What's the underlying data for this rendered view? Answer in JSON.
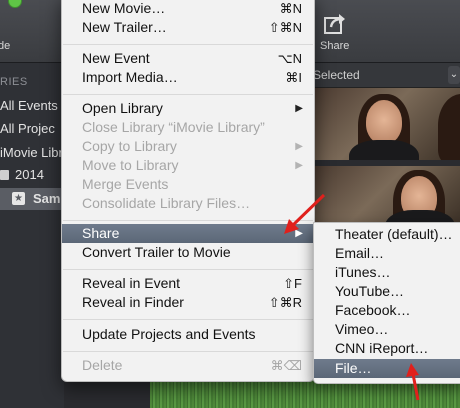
{
  "toolbar": {
    "left_label": "de",
    "share_label": "Share"
  },
  "browser": {
    "selected_label": "Selected",
    "chevron": "⌄"
  },
  "sidebar": {
    "header": "RIES",
    "items": [
      {
        "label": "All Events"
      },
      {
        "label": "All Projec"
      },
      {
        "label": "iMovie Libr"
      },
      {
        "label": "2014"
      },
      {
        "label": "Sam"
      }
    ]
  },
  "menu": {
    "items": [
      {
        "label": "New Movie…",
        "shortcut": "⌘N",
        "enabled": true
      },
      {
        "label": "New Trailer…",
        "shortcut": "⇧⌘N",
        "enabled": true
      },
      {
        "label": "New Event",
        "shortcut": "⌥N",
        "enabled": true
      },
      {
        "label": "Import Media…",
        "shortcut": "⌘I",
        "enabled": true
      },
      {
        "label": "Open Library",
        "submenu": true,
        "enabled": true
      },
      {
        "label": "Close Library “iMovie Library”",
        "enabled": false
      },
      {
        "label": "Copy to Library",
        "submenu": true,
        "enabled": false
      },
      {
        "label": "Move to Library",
        "submenu": true,
        "enabled": false
      },
      {
        "label": "Merge Events",
        "enabled": false
      },
      {
        "label": "Consolidate Library Files…",
        "enabled": false
      },
      {
        "label": "Share",
        "submenu": true,
        "enabled": true,
        "highlighted": true
      },
      {
        "label": "Convert Trailer to Movie",
        "enabled": true
      },
      {
        "label": "Reveal in Event",
        "shortcut": "⇧F",
        "enabled": true
      },
      {
        "label": "Reveal in Finder",
        "shortcut": "⇧⌘R",
        "enabled": true
      },
      {
        "label": "Update Projects and Events",
        "enabled": true
      },
      {
        "label": "Delete",
        "shortcut": "⌘⌫",
        "enabled": false
      }
    ],
    "submenu_arrow": "▶"
  },
  "share_submenu": {
    "items": [
      {
        "label": "Theater (default)…"
      },
      {
        "label": "Email…"
      },
      {
        "label": "iTunes…"
      },
      {
        "label": "YouTube…"
      },
      {
        "label": "Facebook…"
      },
      {
        "label": "Vimeo…"
      },
      {
        "label": "CNN iReport…"
      },
      {
        "label": "File…",
        "highlighted": true
      }
    ]
  },
  "colors": {
    "highlight": "#5f6b7b",
    "annotation_arrow": "#e0201c"
  }
}
